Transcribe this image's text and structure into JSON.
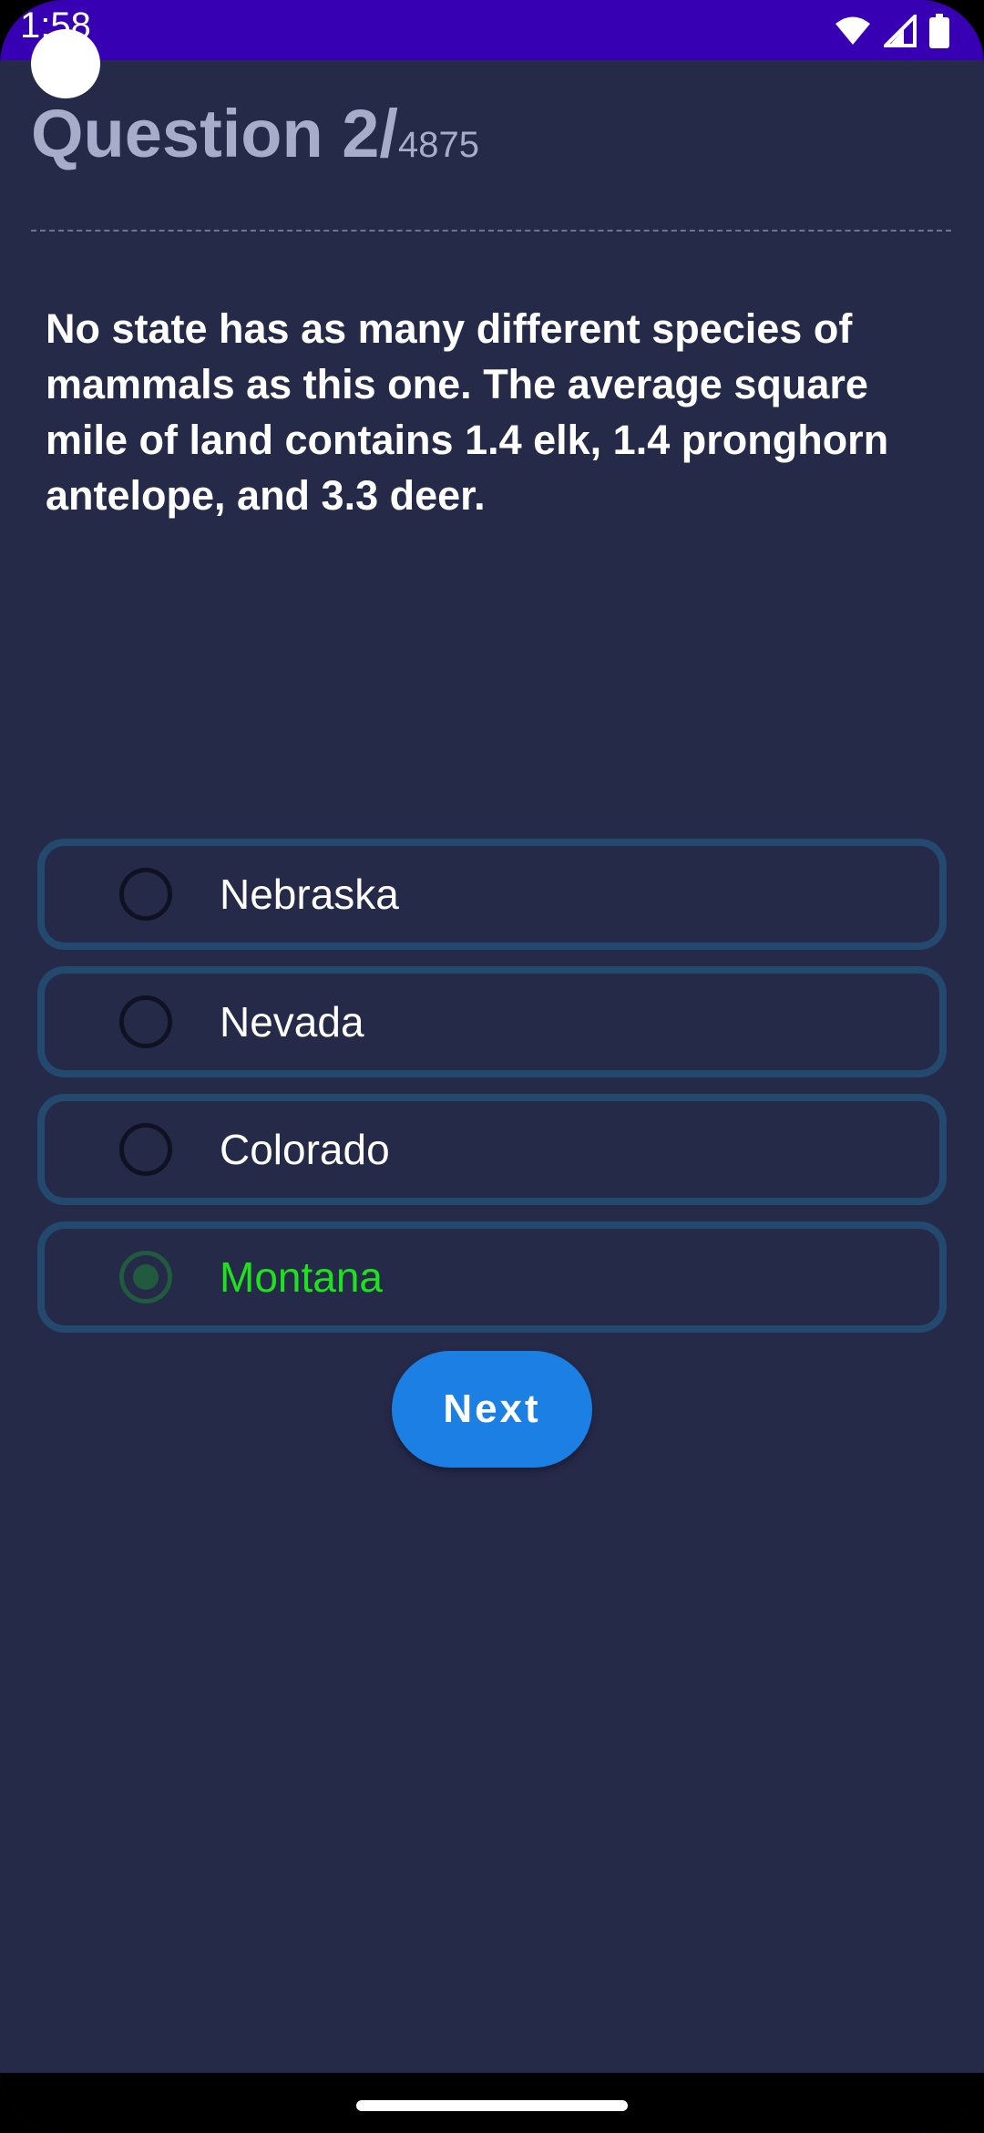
{
  "status_bar": {
    "time": "1:58",
    "icons": [
      "wifi-icon",
      "cellular-signal-icon",
      "battery-icon"
    ],
    "background": "#3700b3"
  },
  "header": {
    "title": "Question 2/",
    "total": "4875"
  },
  "question": {
    "text": "No state has as many different species of mammals as this one. The average square mile of land contains 1.4 elk, 1.4 pronghorn antelope, and 3.3 deer."
  },
  "options": [
    {
      "label": "Nebraska",
      "selected": false
    },
    {
      "label": "Nevada",
      "selected": false
    },
    {
      "label": "Colorado",
      "selected": false
    },
    {
      "label": "Montana",
      "selected": true
    }
  ],
  "actions": {
    "next_label": "Next"
  },
  "colors": {
    "background": "#262a49",
    "option_border": "#24496f",
    "selected_text": "#1ee21e",
    "button": "#1b7fe3",
    "title": "#a7acc9"
  }
}
